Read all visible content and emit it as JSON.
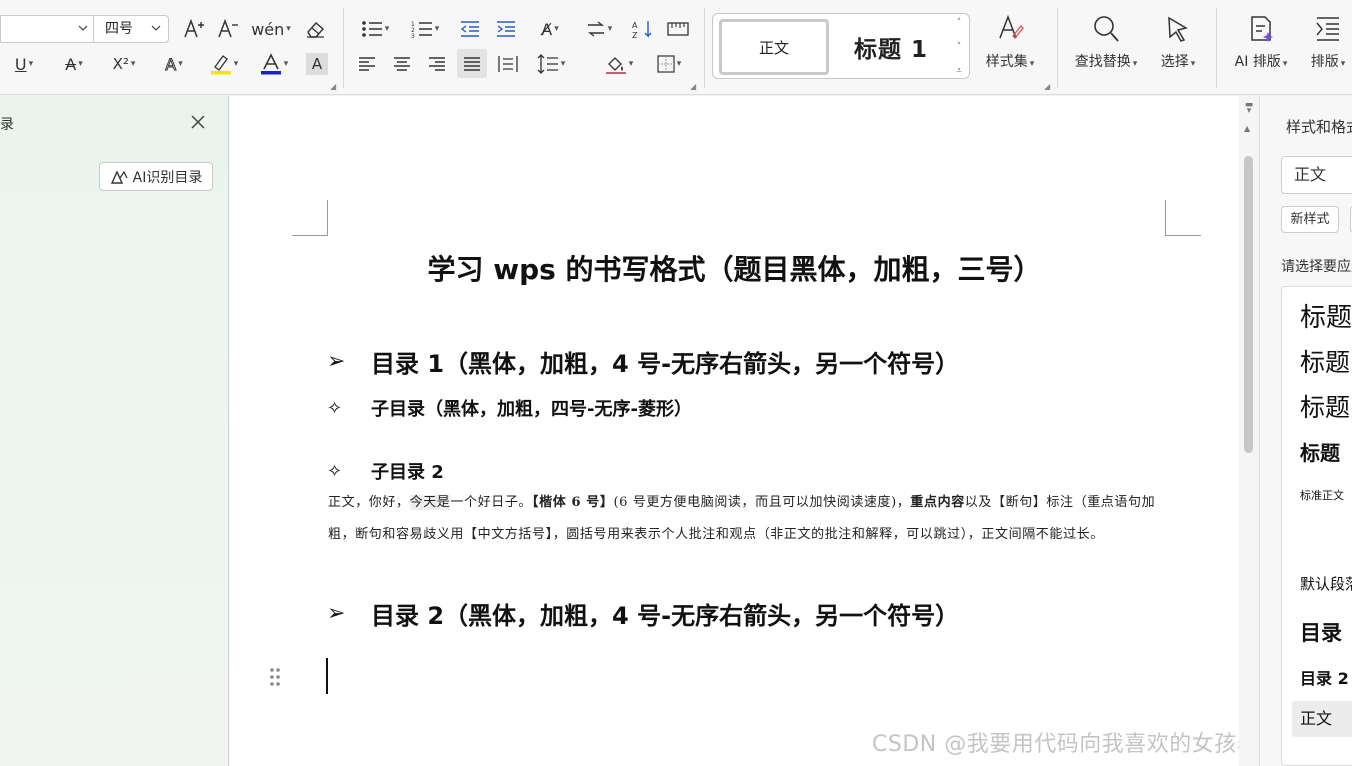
{
  "ribbon": {
    "font_size_value": "四号",
    "styles_gallery": {
      "normal": "正文",
      "heading1": "标题 1"
    },
    "buttons": {
      "style_set": "样式集",
      "find_replace": "查找替换",
      "select": "选择",
      "ai_layout": "AI 排版",
      "layout": "排版"
    }
  },
  "nav_pane": {
    "title_fragment": "录",
    "ai_toc_button": "AI识别目录"
  },
  "document": {
    "title": "学习 wps 的书写格式（题目黑体，加粗，三号）",
    "h1_bullet": "➢",
    "h2_bullet": "✧",
    "heading1_a": "目录 1（黑体，加粗，4 号-无序右箭头，另一个符号）",
    "sub1": "子目录（黑体，加粗，四号-无序-菱形）",
    "sub2": "子目录 2",
    "body": {
      "p1": "正文，你好，",
      "p2": "今天是",
      "p3": "一个好日子。",
      "p4": "【楷体 6 号】",
      "p5": "(6 号更方便电脑阅读，而且可以加快阅读速度)，",
      "p6": "重点内容",
      "p7": "以及【断句】标注（重点语句加粗，断句和容易歧义用【中文方括号】，圆括号用来表示个人批注和观点（非正文的批注和解释，可以跳过），正文间隔不能过长。"
    },
    "heading1_b": "目录 2（黑体，加粗，4 号-无序右箭头，另一个符号）"
  },
  "watermark": "CSDN @我要用代码向我喜欢的女孩表白",
  "style_pane": {
    "title": "样式和格式",
    "current_style": "正文",
    "new_style_button": "新样式",
    "hint": "请选择要应用的格式",
    "items": [
      "标题",
      "标题",
      "标题",
      "标题",
      "标准正文",
      "默认段落",
      "目录",
      "目录 2",
      "正文"
    ]
  }
}
